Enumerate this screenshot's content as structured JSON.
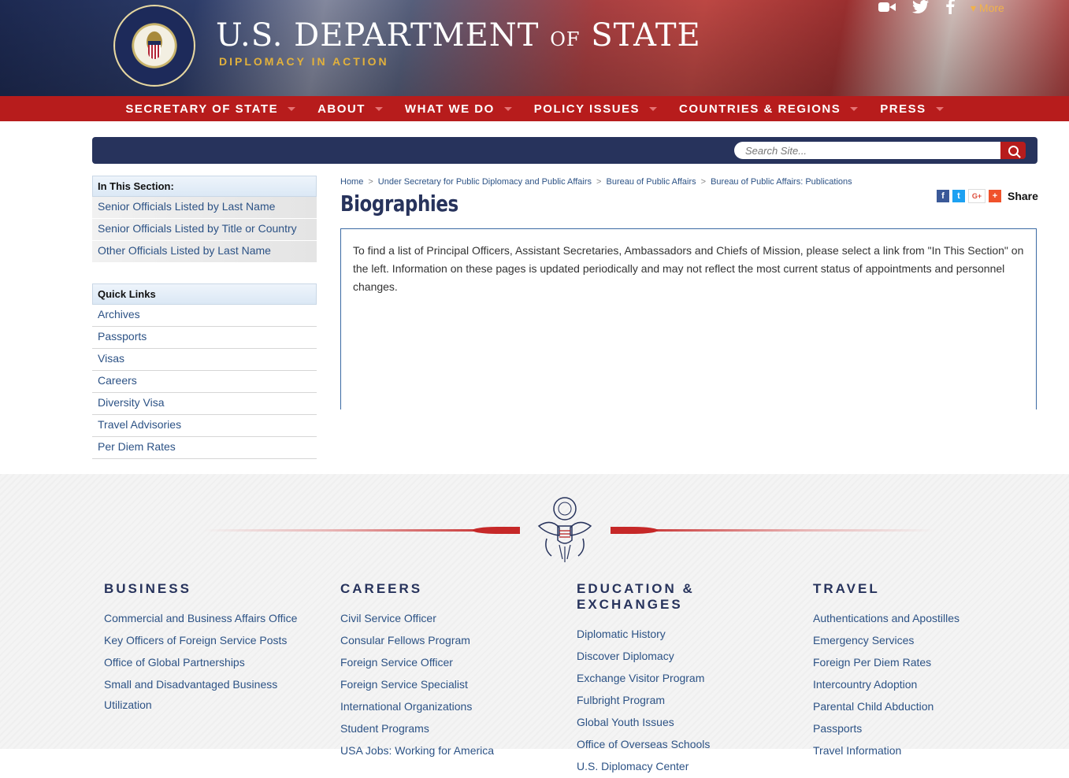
{
  "header": {
    "title_main": "U.S. DEPARTMENT",
    "title_of": "OF",
    "title_state": "STATE",
    "tagline": "DIPLOMACY IN ACTION",
    "more_label": "More",
    "social_icons": [
      "video-icon",
      "twitter-icon",
      "facebook-icon"
    ]
  },
  "nav": {
    "items": [
      {
        "label": "SECRETARY OF STATE"
      },
      {
        "label": "ABOUT"
      },
      {
        "label": "WHAT WE DO"
      },
      {
        "label": "POLICY ISSUES"
      },
      {
        "label": "COUNTRIES & REGIONS"
      },
      {
        "label": "PRESS"
      }
    ]
  },
  "search": {
    "placeholder": "Search Site..."
  },
  "sidebar": {
    "section_heading": "In This Section:",
    "section_links": [
      "Senior Officials Listed by Last Name",
      "Senior Officials Listed by Title or Country",
      "Other Officials Listed by Last Name"
    ],
    "quick_heading": "Quick Links",
    "quick_links": [
      "Archives",
      "Passports",
      "Visas",
      "Careers",
      "Diversity Visa",
      "Travel Advisories",
      "Per Diem Rates"
    ]
  },
  "breadcrumb": [
    "Home",
    "Under Secretary for Public Diplomacy and Public Affairs",
    "Bureau of Public Affairs",
    "Bureau of Public Affairs: Publications"
  ],
  "breadcrumb_separator": ">",
  "main": {
    "title": "Biographies",
    "body": "To find a list of Principal Officers, Assistant Secretaries, Ambassadors and Chiefs of Mission, please select a link from \"In This Section\" on the left. Information on these pages is updated periodically and may not reflect the most current status of appointments and personnel changes."
  },
  "share": {
    "label": "Share",
    "buttons": [
      {
        "icon": "facebook-icon",
        "glyph": "f",
        "color": "#3b5998"
      },
      {
        "icon": "twitter-icon",
        "glyph": "t",
        "color": "#1da1f2"
      },
      {
        "icon": "google-plus-icon",
        "glyph": "G+",
        "color": "#dd4b39"
      },
      {
        "icon": "plus-icon",
        "glyph": "+",
        "color": "#f0522b"
      }
    ]
  },
  "footer": {
    "columns": [
      {
        "heading": "BUSINESS",
        "links": [
          "Commercial and Business Affairs Office",
          "Key Officers of Foreign Service Posts",
          "Office of Global Partnerships",
          "Small and Disadvantaged Business Utilization"
        ]
      },
      {
        "heading": "CAREERS",
        "links": [
          "Civil Service Officer",
          "Consular Fellows Program",
          "Foreign Service Officer",
          "Foreign Service Specialist",
          "International Organizations",
          "Student Programs",
          "USA Jobs: Working for America"
        ]
      },
      {
        "heading": "EDUCATION & EXCHANGES",
        "links": [
          "Diplomatic History",
          "Discover Diplomacy",
          "Exchange Visitor Program",
          "Fulbright Program",
          "Global Youth Issues",
          "Office of Overseas Schools",
          "U.S. Diplomacy Center"
        ]
      },
      {
        "heading": "TRAVEL",
        "links": [
          "Authentications and Apostilles",
          "Emergency Services",
          "Foreign Per Diem Rates",
          "Intercountry Adoption",
          "Parental Child Abduction",
          "Passports",
          "Travel Information"
        ]
      }
    ]
  },
  "colors": {
    "nav_red": "#b71c1c",
    "navy": "#27335c",
    "link_blue": "#2c5285",
    "gold": "#e2b13c"
  }
}
